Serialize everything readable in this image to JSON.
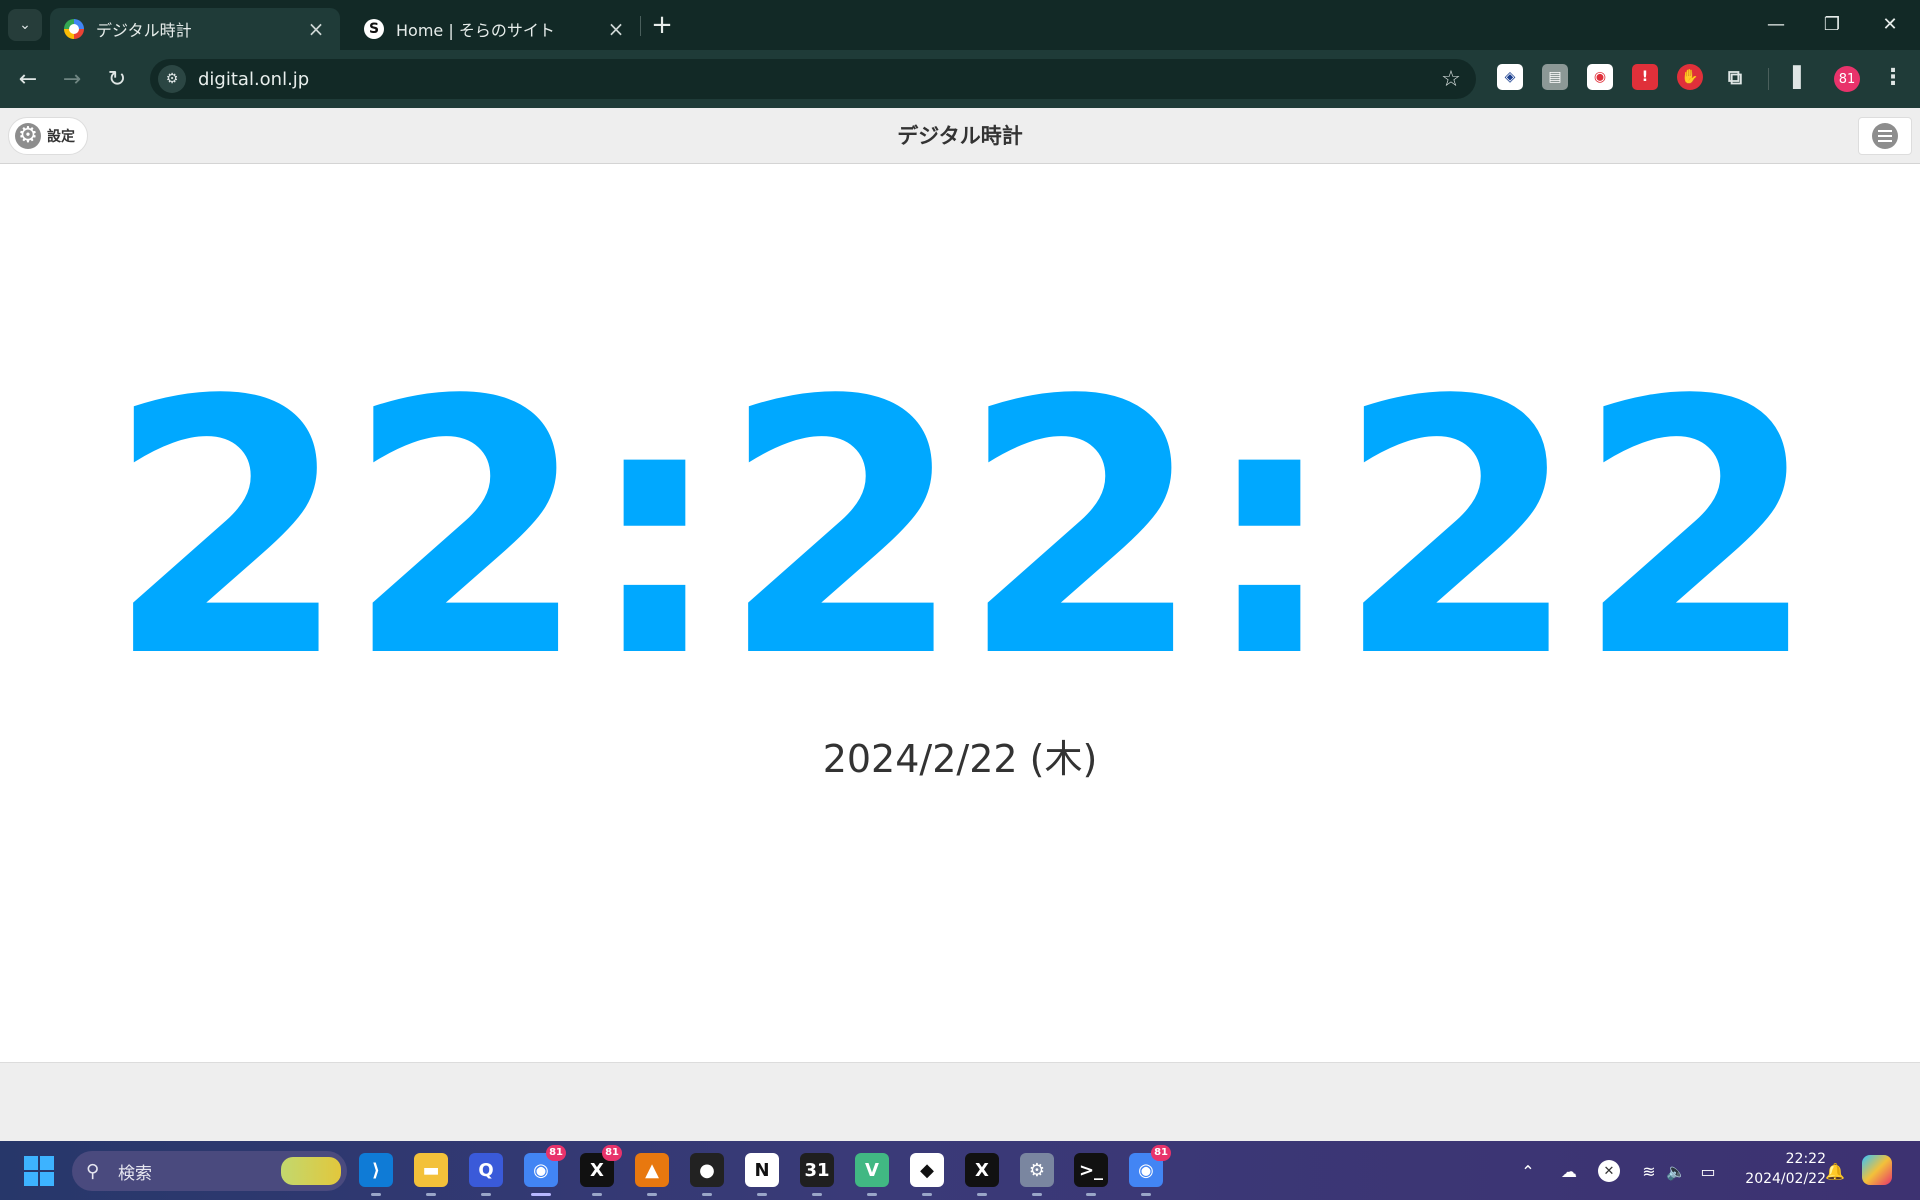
{
  "browser": {
    "tabs": [
      {
        "title": "デジタル時計",
        "active": true,
        "favicon": "clock-favicon"
      },
      {
        "title": "Home | そらのサイト",
        "active": false,
        "favicon": "s-favicon",
        "favicon_letter": "S"
      }
    ],
    "new_tab_label": "+",
    "address": "digital.onl.jp",
    "profile_label": "81"
  },
  "page": {
    "settings_label": "設定",
    "title": "デジタル時計",
    "time": "22:22:22",
    "date": "2024/2/22 (木)",
    "accent_color": "#00a8ff"
  },
  "taskbar": {
    "search_placeholder": "検索",
    "apps": [
      {
        "name": "vscode",
        "label": "⟩",
        "color": "#0f7bd6"
      },
      {
        "name": "file-explorer",
        "label": "▬",
        "color": "#f3c13a"
      },
      {
        "name": "app-q",
        "label": "Q",
        "color": "#3a5ad9"
      },
      {
        "name": "chrome",
        "label": "◉",
        "color": "#4285f4",
        "badge": "81",
        "active": true
      },
      {
        "name": "x",
        "label": "X",
        "color": "#111111",
        "badge": "81"
      },
      {
        "name": "app-orange",
        "label": "▲",
        "color": "#e8780f"
      },
      {
        "name": "github",
        "label": "●",
        "color": "#222222"
      },
      {
        "name": "notion",
        "label": "N",
        "color": "#ffffff"
      },
      {
        "name": "calendar",
        "label": "31",
        "color": "#1f1f1f"
      },
      {
        "name": "vue",
        "label": "V",
        "color": "#41b883"
      },
      {
        "name": "app-dice",
        "label": "◆",
        "color": "#ffffff"
      },
      {
        "name": "x-second",
        "label": "X",
        "color": "#111111"
      },
      {
        "name": "settings",
        "label": "⚙",
        "color": "#7a86a0"
      },
      {
        "name": "terminal",
        "label": ">_",
        "color": "#111111"
      },
      {
        "name": "chrome-second",
        "label": "◉",
        "color": "#4285f4",
        "badge": "81"
      }
    ],
    "time": "22:22",
    "date": "2024/02/22"
  }
}
